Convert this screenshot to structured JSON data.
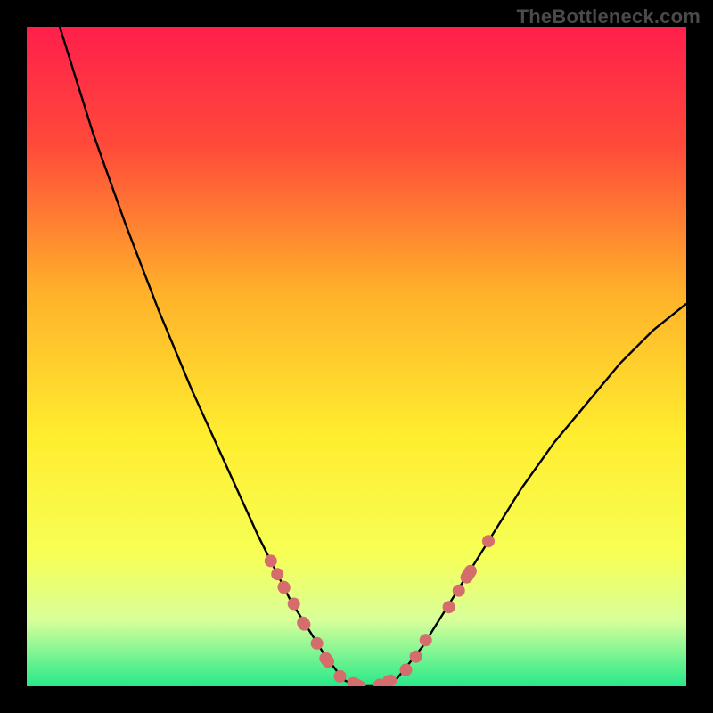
{
  "watermark": "TheBottleneck.com",
  "chart_data": {
    "type": "line",
    "title": "",
    "xlabel": "",
    "ylabel": "",
    "xlim": [
      0,
      100
    ],
    "ylim": [
      0,
      100
    ],
    "gradient_stops": [
      {
        "offset": 0,
        "color": "#ff1f4b"
      },
      {
        "offset": 18,
        "color": "#ff4a3a"
      },
      {
        "offset": 40,
        "color": "#ffb02a"
      },
      {
        "offset": 62,
        "color": "#ffed2f"
      },
      {
        "offset": 80,
        "color": "#f7ff55"
      },
      {
        "offset": 90,
        "color": "#d8ff9a"
      },
      {
        "offset": 100,
        "color": "#27e98a"
      }
    ],
    "curve": [
      {
        "x": 5,
        "y": 100
      },
      {
        "x": 10,
        "y": 84
      },
      {
        "x": 15,
        "y": 70
      },
      {
        "x": 20,
        "y": 57
      },
      {
        "x": 25,
        "y": 45
      },
      {
        "x": 30,
        "y": 34
      },
      {
        "x": 35,
        "y": 23
      },
      {
        "x": 40,
        "y": 13
      },
      {
        "x": 45,
        "y": 5
      },
      {
        "x": 48,
        "y": 1
      },
      {
        "x": 50,
        "y": 0
      },
      {
        "x": 53,
        "y": 0
      },
      {
        "x": 56,
        "y": 1
      },
      {
        "x": 60,
        "y": 6
      },
      {
        "x": 65,
        "y": 14
      },
      {
        "x": 70,
        "y": 22
      },
      {
        "x": 75,
        "y": 30
      },
      {
        "x": 80,
        "y": 37
      },
      {
        "x": 85,
        "y": 43
      },
      {
        "x": 90,
        "y": 49
      },
      {
        "x": 95,
        "y": 54
      },
      {
        "x": 100,
        "y": 58
      }
    ],
    "markers": [
      {
        "kind": "dot",
        "x": 37,
        "y": 19
      },
      {
        "kind": "dot",
        "x": 38,
        "y": 17
      },
      {
        "kind": "pill",
        "x": 39,
        "y": 15,
        "len": 2
      },
      {
        "kind": "dot",
        "x": 40.5,
        "y": 12.5
      },
      {
        "kind": "pill",
        "x": 42,
        "y": 9.5,
        "len": 2.2
      },
      {
        "kind": "dot",
        "x": 44,
        "y": 6.5
      },
      {
        "kind": "pill",
        "x": 45.5,
        "y": 4,
        "len": 2.5
      },
      {
        "kind": "dot",
        "x": 47.5,
        "y": 1.5
      },
      {
        "kind": "pill",
        "x": 50,
        "y": 0.2,
        "len": 3
      },
      {
        "kind": "dot",
        "x": 53.5,
        "y": 0.2
      },
      {
        "kind": "pill",
        "x": 55,
        "y": 0.8,
        "len": 2.2
      },
      {
        "kind": "dot",
        "x": 57.5,
        "y": 2.5
      },
      {
        "kind": "dot",
        "x": 59,
        "y": 4.5
      },
      {
        "kind": "dot",
        "x": 60.5,
        "y": 7
      },
      {
        "kind": "dot",
        "x": 64,
        "y": 12
      },
      {
        "kind": "dot",
        "x": 65.5,
        "y": 14.5
      },
      {
        "kind": "pill",
        "x": 67,
        "y": 17,
        "len": 3
      },
      {
        "kind": "dot",
        "x": 70,
        "y": 22
      }
    ],
    "marker_color": "#d66d6d",
    "curve_color": "#000000"
  }
}
